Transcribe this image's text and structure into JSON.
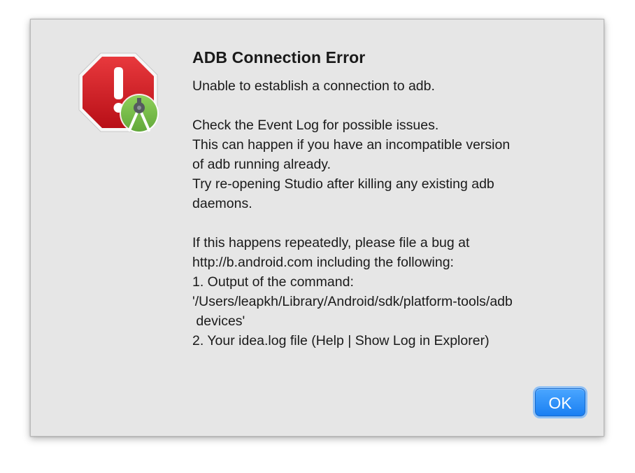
{
  "dialog": {
    "title": "ADB Connection Error",
    "icon": "stop-sign-android-studio-icon",
    "message_lines": [
      "Unable to establish a connection to adb.",
      "",
      "Check the Event Log for possible issues.",
      "This can happen if you have an incompatible version",
      "of adb running already.",
      "Try re-opening Studio after killing any existing adb",
      "daemons.",
      "",
      "If this happens repeatedly, please file a bug at",
      "http://b.android.com including the following:",
      "1. Output of the command:",
      "'/Users/leapkh/Library/Android/sdk/platform-tools/adb",
      " devices'",
      "2. Your idea.log file (Help | Show Log in Explorer)"
    ],
    "ok_label": "OK"
  },
  "colors": {
    "dialog_background": "#e6e6e6",
    "stop_sign_red": "#d0171f",
    "android_green": "#7cbd4a",
    "button_blue": "#1a7ff2"
  }
}
